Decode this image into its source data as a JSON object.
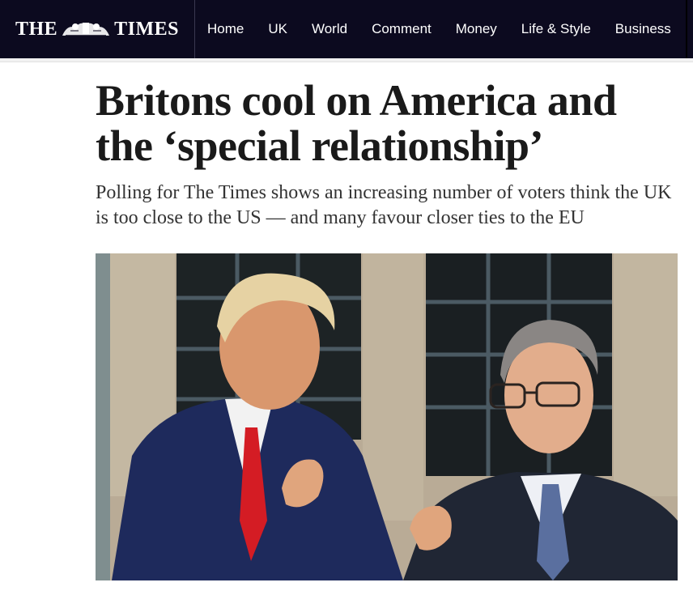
{
  "brand": {
    "logo_left": "THE",
    "logo_right": "TIMES",
    "crest_icon": "royal-crest-icon"
  },
  "nav": {
    "items": [
      {
        "label": "Home"
      },
      {
        "label": "UK"
      },
      {
        "label": "World"
      },
      {
        "label": "Comment"
      },
      {
        "label": "Money"
      },
      {
        "label": "Life & Style"
      },
      {
        "label": "Business"
      }
    ]
  },
  "article": {
    "headline": "Britons cool on America and the ‘special relationship’",
    "standfirst": "Polling for The Times shows an increasing number of voters think the UK is too close to the US — and many favour closer ties to the EU"
  },
  "colors": {
    "masthead_bg": "#0c0a1f",
    "nav_text": "#ffffff",
    "headline": "#1a1a1a",
    "standfirst": "#333333"
  }
}
